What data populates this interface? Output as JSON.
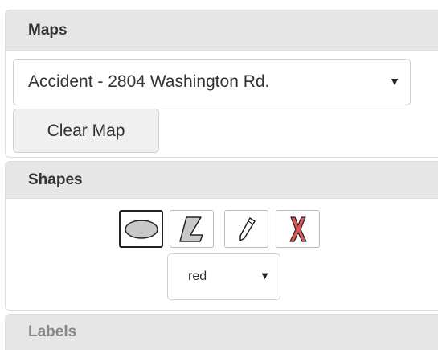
{
  "maps_panel": {
    "title": "Maps",
    "selected_map": "Accident - 2804 Washington Rd.",
    "clear_button": "Clear Map"
  },
  "shapes_panel": {
    "title": "Shapes",
    "tools": [
      {
        "icon": "ellipse-icon",
        "active": true
      },
      {
        "icon": "polygon-icon",
        "active": false
      },
      {
        "icon": "pencil-icon",
        "active": false
      },
      {
        "icon": "delete-icon",
        "active": false
      }
    ],
    "selected_color": "red"
  },
  "labels_panel": {
    "title": "Labels"
  },
  "colors": {
    "header_bg": "#e6e6e6",
    "ellipse_fill": "#c8c8c8",
    "polygon_fill": "#c8c8c8",
    "delete_red": "#cc3333"
  }
}
